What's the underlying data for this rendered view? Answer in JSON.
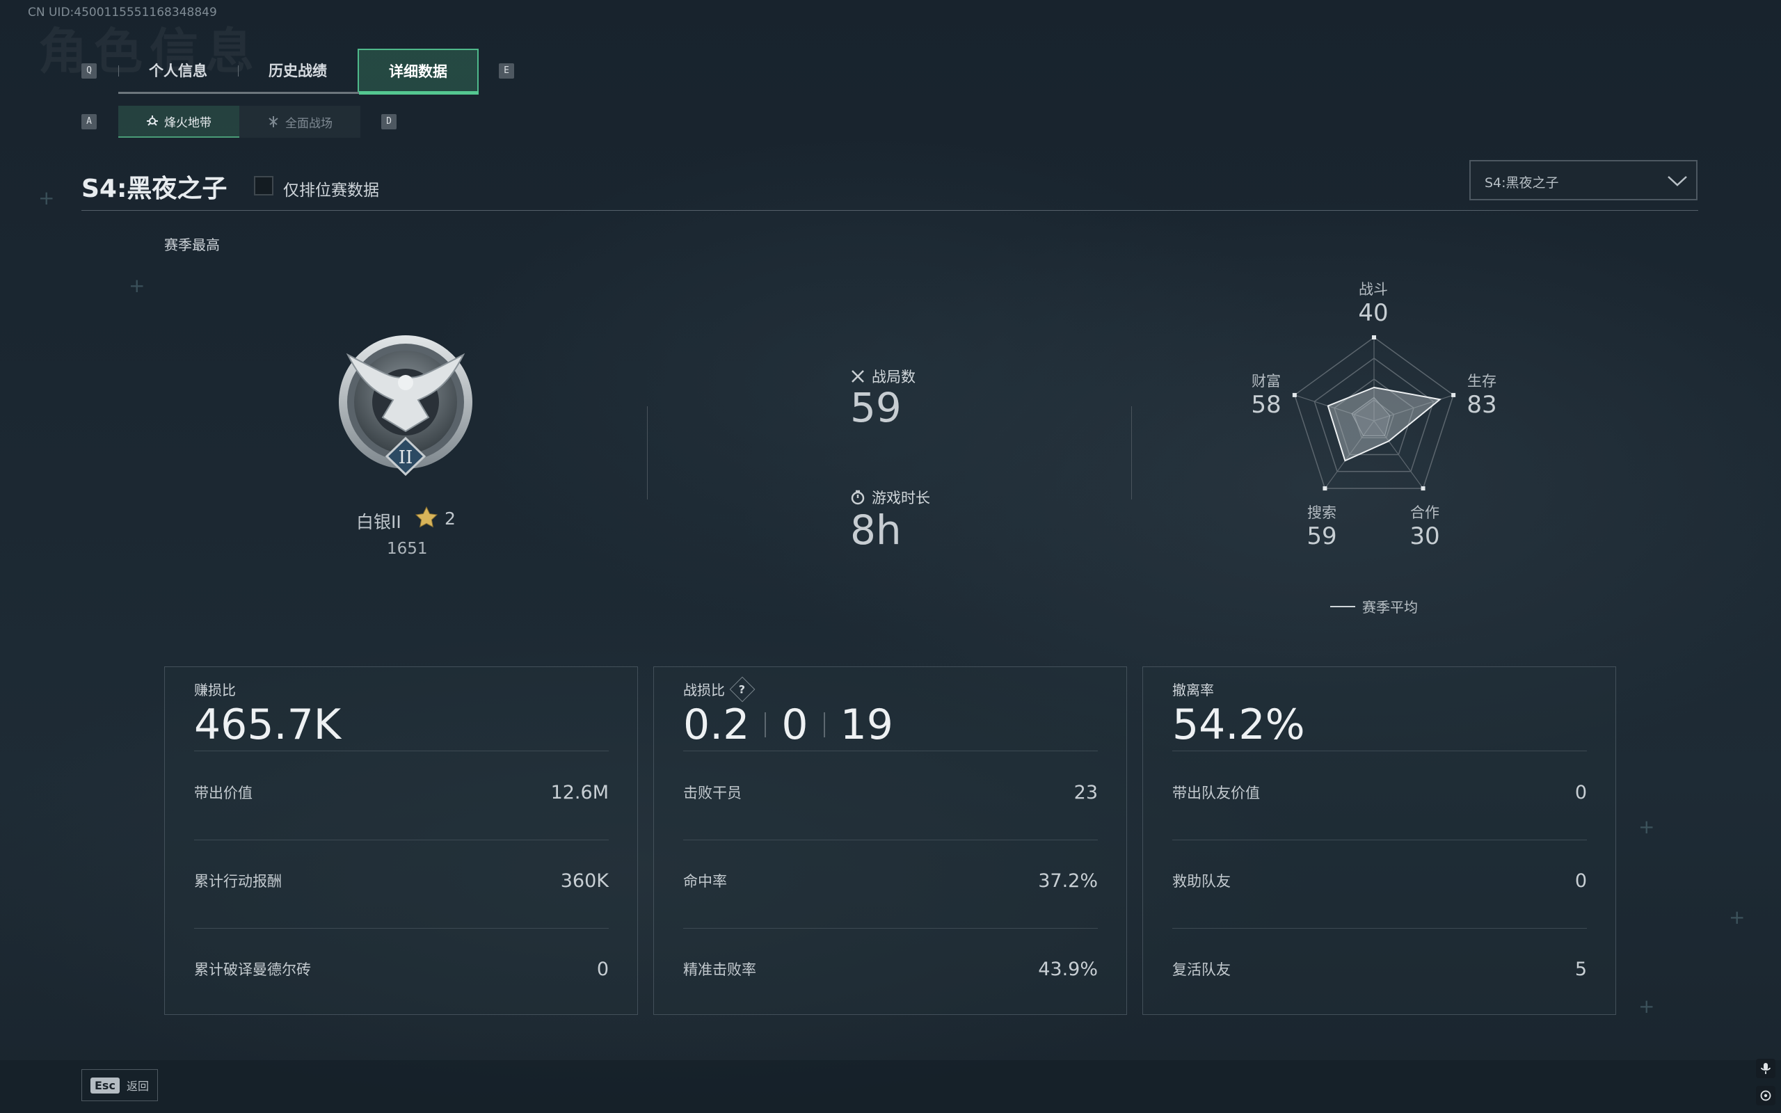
{
  "uid": "CN UID:4500115551168348849",
  "background_title": "角色信息",
  "keys": {
    "prev_tab": "Q",
    "next_tab": "E",
    "prev_sub": "A",
    "next_sub": "D"
  },
  "tabs": [
    {
      "label": "个人信息",
      "active": false
    },
    {
      "label": "历史战绩",
      "active": false
    },
    {
      "label": "详细数据",
      "active": true
    }
  ],
  "subtabs": [
    {
      "label": "烽火地带",
      "icon": "flame-zone-icon",
      "active": true
    },
    {
      "label": "全面战场",
      "icon": "battlefield-icon",
      "active": false
    }
  ],
  "season": {
    "title": "S4:黑夜之子",
    "ranked_only_label": "仅排位赛数据",
    "ranked_only_checked": false,
    "dropdown_value": "S4:黑夜之子"
  },
  "season_best_label": "赛季最高",
  "rank": {
    "badge_numeral": "II",
    "name": "白银II",
    "stars": "2",
    "score": "1651"
  },
  "center_stats": {
    "matches_label": "战局数",
    "matches_value": "59",
    "playtime_label": "游戏时长",
    "playtime_value": "8h"
  },
  "radar": {
    "axes": [
      {
        "label": "战斗",
        "value": "40",
        "score": 40
      },
      {
        "label": "生存",
        "value": "83",
        "score": 83
      },
      {
        "label": "合作",
        "value": "30",
        "score": 30
      },
      {
        "label": "搜索",
        "value": "59",
        "score": 59
      },
      {
        "label": "财富",
        "value": "58",
        "score": 58
      }
    ],
    "average_label": "赛季平均",
    "average_shape": [
      28,
      20,
      22,
      22,
      28
    ]
  },
  "panels": [
    {
      "title": "赚损比",
      "big": [
        "465.7K"
      ],
      "rows": [
        {
          "label": "带出价值",
          "value": "12.6M"
        },
        {
          "label": "累计行动报酬",
          "value": "360K"
        },
        {
          "label": "累计破译曼德尔砖",
          "value": "0"
        }
      ]
    },
    {
      "title": "战损比",
      "help": "?",
      "big": [
        "0.2",
        "0",
        "19"
      ],
      "rows": [
        {
          "label": "击败干员",
          "value": "23"
        },
        {
          "label": "命中率",
          "value": "37.2%"
        },
        {
          "label": "精准击败率",
          "value": "43.9%"
        }
      ]
    },
    {
      "title": "撤离率",
      "big": [
        "54.2%"
      ],
      "rows": [
        {
          "label": "带出队友价值",
          "value": "0"
        },
        {
          "label": "救助队友",
          "value": "0"
        },
        {
          "label": "复活队友",
          "value": "5"
        }
      ]
    }
  ],
  "footer": {
    "esc_key": "Esc",
    "back_label": "返回"
  },
  "colors": {
    "accent": "#4fb98b",
    "accent_line": "#54c790",
    "gold_star": "#d8b45a"
  }
}
